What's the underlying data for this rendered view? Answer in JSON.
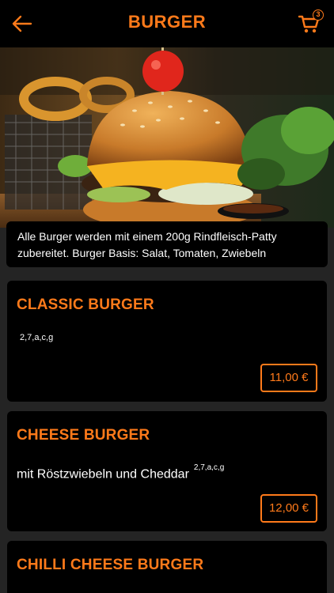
{
  "header": {
    "title": "BURGER",
    "cart_count": "3",
    "accent_color": "#ff7a1a"
  },
  "icons": {
    "back": "arrow-left-icon",
    "cart": "shopping-cart-icon"
  },
  "category_note": "Alle Burger werden mit einem 200g Rindfleisch-Patty zubereitet. Burger Basis: Salat, Tomaten, Zwiebeln",
  "items": [
    {
      "name": "CLASSIC BURGER",
      "description": "",
      "allergens": "2,7,a,c,g",
      "price": "11,00 €"
    },
    {
      "name": "CHEESE BURGER",
      "description": "mit Röstzwiebeln und Cheddar",
      "allergens": "2,7,a,c,g",
      "price": "12,00 €"
    },
    {
      "name": "CHILLI CHEESE BURGER"
    }
  ]
}
